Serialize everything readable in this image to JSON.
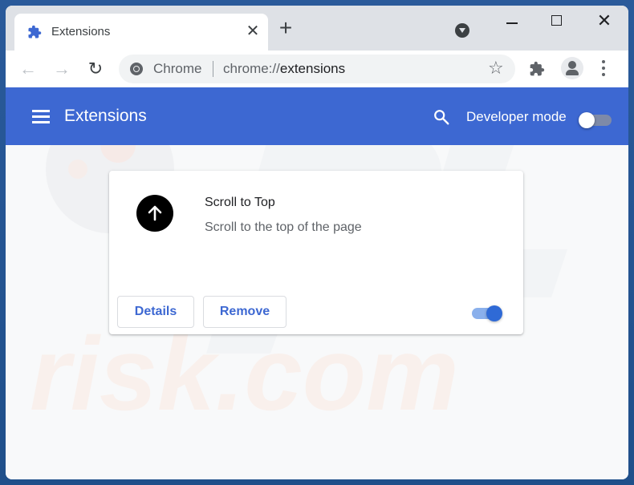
{
  "browser": {
    "tab": {
      "title": "Extensions",
      "icon": "puzzle-piece-icon",
      "close_glyph": "✕"
    },
    "new_tab_glyph": "+",
    "window_controls": {
      "minimize": "minimize",
      "maximize": "maximize",
      "close_glyph": "✕"
    },
    "toolbar": {
      "back_glyph": "←",
      "forward_glyph": "→",
      "reload_glyph": "↻",
      "site_label": "Chrome",
      "url_scheme": "chrome://",
      "url_host": "extensions",
      "star_glyph": "☆"
    }
  },
  "header": {
    "title": "Extensions",
    "developer_mode_label": "Developer mode",
    "developer_mode_enabled": false
  },
  "extensions": [
    {
      "name": "Scroll to Top",
      "description": "Scroll to the top of the page",
      "details_label": "Details",
      "remove_label": "Remove",
      "enabled": true
    }
  ],
  "colors": {
    "accent": "#3d68d2",
    "header_bg": "#3d68d2",
    "page_bg": "#f8f9fa",
    "toggle_on": "#2f6ad6"
  }
}
